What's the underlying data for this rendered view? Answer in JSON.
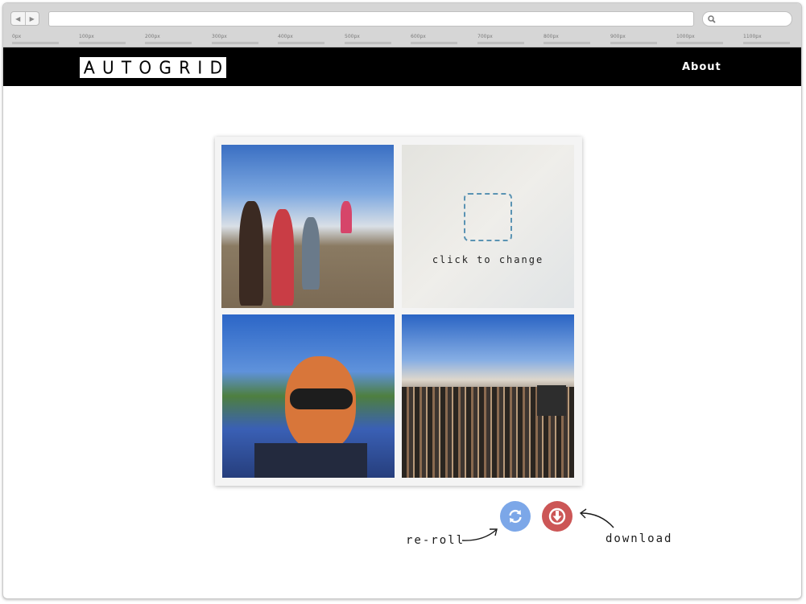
{
  "browser": {
    "back_icon": "left-triangle-icon",
    "forward_icon": "right-triangle-icon",
    "search_icon": "magnifier-icon",
    "ruler_ticks": [
      "0px",
      "100px",
      "200px",
      "300px",
      "400px",
      "500px",
      "600px",
      "700px",
      "800px",
      "900px",
      "1000px",
      "1100px"
    ]
  },
  "site": {
    "logo_letters": [
      "A",
      "U",
      "T",
      "O",
      "G",
      "R",
      "I",
      "D"
    ],
    "nav_about": "About",
    "header_color": "#000000"
  },
  "grid": {
    "tiles": [
      {
        "name": "festival-crowd-walking-photo"
      },
      {
        "name": "empty-slot",
        "label": "click to change"
      },
      {
        "name": "face-paint-selfie-photo"
      },
      {
        "name": "festival-audience-photo"
      }
    ]
  },
  "actions": {
    "reroll_label": "re-roll",
    "download_label": "download",
    "reroll_color": "#7ca7e8",
    "download_color": "#cc5656"
  }
}
